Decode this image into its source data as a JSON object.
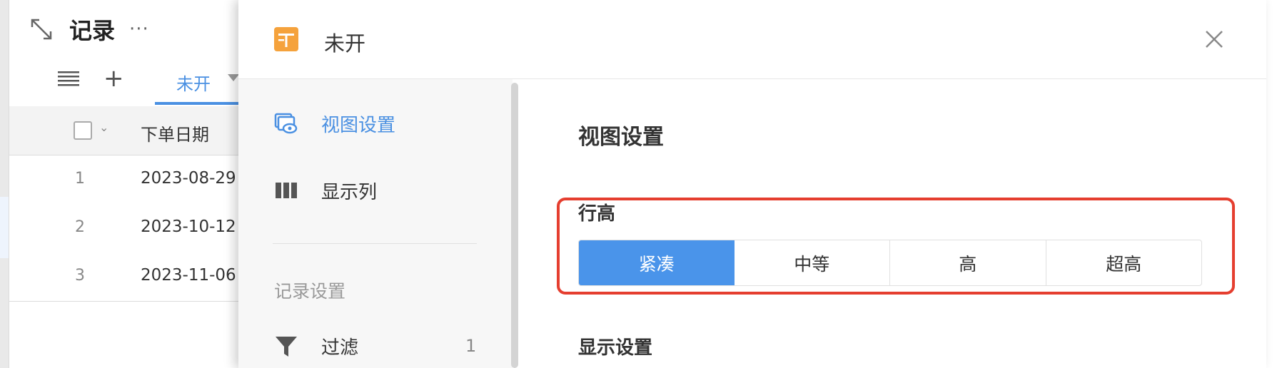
{
  "app": {
    "title": "记录",
    "more": "···",
    "tab_label": "未开",
    "column_header": "下单日期",
    "rows": [
      {
        "index": "1",
        "date": "2023-08-29"
      },
      {
        "index": "2",
        "date": "2023-10-12"
      },
      {
        "index": "3",
        "date": "2023-11-06"
      }
    ]
  },
  "dialog": {
    "title": "未开",
    "sidebar": {
      "items": [
        {
          "label": "视图设置",
          "icon": "view-settings-icon",
          "active": true
        },
        {
          "label": "显示列",
          "icon": "columns-icon",
          "active": false
        }
      ],
      "section_title": "记录设置",
      "filter": {
        "label": "过滤",
        "icon": "filter-icon",
        "count": "1"
      }
    },
    "content": {
      "title": "视图设置",
      "row_height": {
        "label": "行高",
        "options": [
          "紧凑",
          "中等",
          "高",
          "超高"
        ],
        "selected": "紧凑"
      },
      "display_settings_label": "显示设置"
    }
  },
  "colors": {
    "accent": "#4a90e2",
    "selected_segment": "#4a94ea",
    "highlight_border": "#e53e2f",
    "app_icon": "#f5a23c"
  }
}
